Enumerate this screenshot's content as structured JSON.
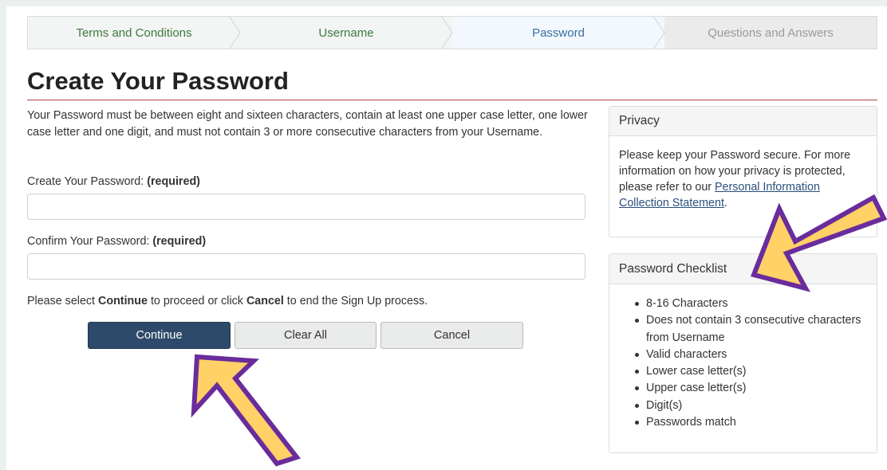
{
  "steps": [
    {
      "label": "Terms and Conditions",
      "state": "done"
    },
    {
      "label": "Username",
      "state": "done"
    },
    {
      "label": "Password",
      "state": "active"
    },
    {
      "label": "Questions and Answers",
      "state": "future"
    }
  ],
  "title": "Create Your Password",
  "intro": "Your Password must be between eight and sixteen characters, contain at least one upper case letter, one lower case letter and one digit, and must not contain 3 or more consecutive characters from your Username.",
  "create_field": {
    "label": "Create Your Password:",
    "required": "(required)",
    "value": ""
  },
  "confirm_field": {
    "label": "Confirm Your Password:",
    "required": "(required)",
    "value": ""
  },
  "instructions": {
    "pre": "Please select ",
    "continue": "Continue",
    "mid": " to proceed or click ",
    "cancel": "Cancel",
    "post": " to end the Sign Up process."
  },
  "buttons": {
    "continue": "Continue",
    "clear": "Clear All",
    "cancel": "Cancel"
  },
  "privacy": {
    "heading": "Privacy",
    "text": "Please keep your Password secure. For more information on how your privacy is protected, please refer to our ",
    "link": "Personal Information Collection Statement",
    "end": "."
  },
  "checklist": {
    "heading": "Password Checklist",
    "items": [
      "8-16 Characters",
      "Does not contain 3 consecutive characters from Username",
      "Valid characters",
      "Lower case letter(s)",
      "Upper case letter(s)",
      "Digit(s)",
      "Passwords match"
    ]
  },
  "colors": {
    "primary": "#2e4a6b",
    "arrow_fill": "#ffd166",
    "arrow_stroke": "#6a2c9c",
    "title_rule": "#a94442"
  }
}
